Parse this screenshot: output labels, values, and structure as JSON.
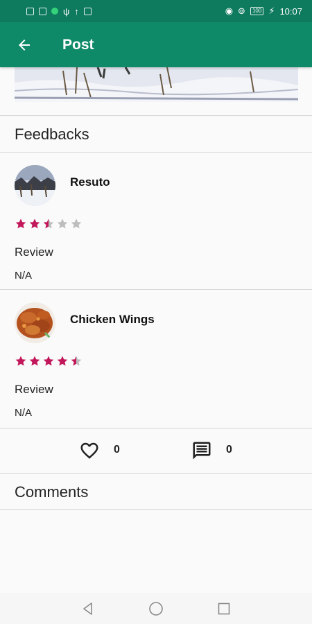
{
  "status_bar": {
    "time": "10:07",
    "battery": "100"
  },
  "app_bar": {
    "title": "Post",
    "back_icon": "arrow-left-icon"
  },
  "feedbacks": {
    "title": "Feedbacks",
    "items": [
      {
        "name": "Resuto",
        "rating": 2.5,
        "max_rating": 5,
        "review_label": "Review",
        "review_text": "N/A",
        "avatar": "snow-landscape-photo"
      },
      {
        "name": "Chicken Wings",
        "rating": 4.5,
        "max_rating": 5,
        "review_label": "Review",
        "review_text": "N/A",
        "avatar": "chicken-wings-photo"
      }
    ]
  },
  "actions": {
    "likes": "0",
    "comments": "0",
    "like_icon": "heart-outline-icon",
    "comment_icon": "comment-icon"
  },
  "comments": {
    "title": "Comments"
  },
  "colors": {
    "primary": "#0f8a69",
    "status_bar": "#0e7a5e",
    "star_filled": "#c2185b",
    "star_empty": "#bdbdbd"
  }
}
